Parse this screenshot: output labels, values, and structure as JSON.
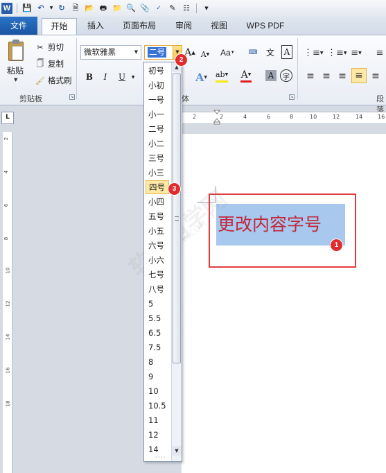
{
  "app": {
    "logo": "W"
  },
  "quick_access": {
    "icons": [
      "save-icon",
      "undo-icon",
      "redo-icon",
      "new-doc-icon",
      "open-folder-icon",
      "print-icon",
      "folder-icon",
      "print-preview-icon",
      "attach-icon",
      "spellcheck-icon",
      "draw-icon",
      "diagram-icon",
      "customize-icon"
    ]
  },
  "tabs": [
    {
      "label": "文件"
    },
    {
      "label": "开始"
    },
    {
      "label": "插入"
    },
    {
      "label": "页面布局"
    },
    {
      "label": "审阅"
    },
    {
      "label": "视图"
    },
    {
      "label": "WPS PDF"
    }
  ],
  "ribbon": {
    "clipboard": {
      "paste_label": "粘贴",
      "cut_label": "剪切",
      "copy_label": "复制",
      "format_painter_label": "格式刷",
      "group_label": "剪贴板"
    },
    "font": {
      "font_name": "微软雅黑",
      "font_size": "二号",
      "group_label": "体",
      "grow_icon": "A",
      "shrink_icon": "A",
      "case_label": "Aa",
      "bold": "B",
      "italic": "I",
      "underline": "U",
      "fill_a": "A",
      "ab_label": "ab",
      "red_a": "A",
      "shade_a": "A",
      "circle_char": "字"
    },
    "paragraph": {
      "group_label": "段落"
    }
  },
  "ruler": {
    "corner_label": "L",
    "h_ticks": [
      "2",
      "2",
      "4",
      "6",
      "8",
      "10",
      "12",
      "14",
      "16"
    ],
    "v_ticks": [
      "2",
      "4",
      "6",
      "8",
      "10",
      "12",
      "14",
      "16",
      "18"
    ]
  },
  "document": {
    "selected_text": "更改内容字号"
  },
  "size_dropdown": {
    "options": [
      "初号",
      "小初",
      "一号",
      "小一",
      "二号",
      "小二",
      "三号",
      "小三",
      "四号",
      "小四",
      "五号",
      "小五",
      "六号",
      "小六",
      "七号",
      "八号",
      "5",
      "5.5",
      "6.5",
      "7.5",
      "8",
      "9",
      "10",
      "10.5",
      "11",
      "12",
      "14"
    ],
    "hovered": "四号"
  },
  "steps": [
    "1",
    "2",
    "3"
  ],
  "watermark": {
    "main": "软件自学网",
    "sub": "WWW.RJZXW.COM"
  },
  "colors": {
    "badge": "#e02c2c",
    "highlight_border": "#e23b3b",
    "selection": "#a8c8ee",
    "text_red": "#c0283c",
    "file_tab": "#1f5fae"
  }
}
